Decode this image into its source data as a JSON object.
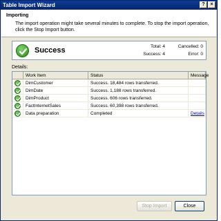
{
  "window": {
    "title": "Table Import Wizard",
    "help_glyph": "?",
    "close_glyph": "×"
  },
  "header": {
    "title": "Importing",
    "description": "The import operation might take several minutes to complete. To stop the import operation, click the Stop Import button."
  },
  "status": {
    "label": "Success",
    "total": "Total: 4",
    "cancelled": "Cancelled: 0",
    "success": "Success: 4",
    "error": "Error: 0",
    "icon": "success-check-icon",
    "color": "#2a8a1a"
  },
  "details": {
    "label": "Details:",
    "columns": [
      "Work Item",
      "Status",
      "Message"
    ],
    "rows": [
      {
        "work_item": "DimCustomer",
        "status": "Success. 18,484 rows transferred.",
        "message": ""
      },
      {
        "work_item": "DimDate",
        "status": "Success. 1,188 rows transferred.",
        "message": ""
      },
      {
        "work_item": "DimProduct",
        "status": "Success. 606 rows transferred.",
        "message": ""
      },
      {
        "work_item": "FactInternetSales",
        "status": "Success. 60,398 rows transferred.",
        "message": ""
      },
      {
        "work_item": "Data preparation",
        "status": "Completed",
        "message": "Details"
      }
    ]
  },
  "buttons": {
    "stop_import": "Stop Import",
    "close": "Close"
  }
}
